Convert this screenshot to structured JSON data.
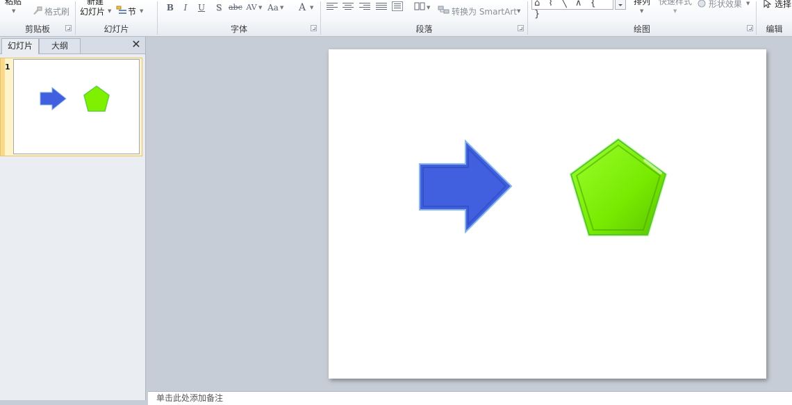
{
  "ribbon": {
    "clipboard": {
      "paste_label": "粘贴",
      "format_painter_label": "格式刷",
      "group_label": "剪贴板"
    },
    "slides": {
      "new_slide_top": "新建",
      "new_slide_label": "幻灯片",
      "section_label": "节",
      "group_label": "幻灯片"
    },
    "font": {
      "bold": "B",
      "italic": "I",
      "underline": "U",
      "shadow": "S",
      "strikethrough": "abc",
      "char_spacing": "AV",
      "change_case": "Aa",
      "font_color": "A",
      "group_label": "字体"
    },
    "paragraph": {
      "smartart_label": "转换为 SmartArt",
      "group_label": "段落"
    },
    "drawing": {
      "shape_gallery": "⌂ ⌇ ╲ ∧ { }",
      "arrange_label": "排列",
      "quick_styles_label": "快速样式",
      "shape_effects_label": "形状效果",
      "group_label": "绘图"
    },
    "editing": {
      "select_label": "选择",
      "group_label": "编辑"
    }
  },
  "left_panel": {
    "tabs": [
      {
        "label": "幻灯片",
        "active": true
      },
      {
        "label": "大纲",
        "active": false
      }
    ],
    "close_icon": "close-icon",
    "thumbnails": [
      {
        "number": "1"
      }
    ]
  },
  "slide": {
    "shapes": [
      {
        "type": "right-arrow",
        "fill": "#4060e0",
        "outline": "#80b0e0"
      },
      {
        "type": "pentagon",
        "fill": "#7ff000",
        "outline": "#5fcf3f"
      }
    ]
  },
  "notes": {
    "placeholder": "单击此处添加备注"
  },
  "colors": {
    "arrow_fill": "#4060e0",
    "pentagon_fill": "#7ff000",
    "selection_highlight": "#fff3c9"
  }
}
